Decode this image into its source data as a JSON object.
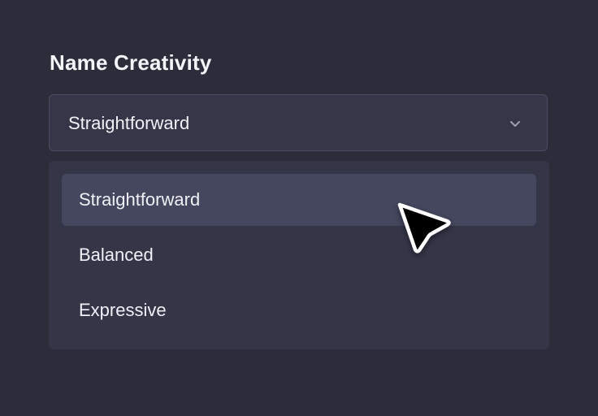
{
  "field": {
    "label": "Name Creativity",
    "selected_value": "Straightforward"
  },
  "icons": {
    "chevron": "chevron-down-icon",
    "cursor": "mouse-pointer-icon"
  },
  "dropdown": {
    "highlighted_index": 0,
    "options": [
      {
        "label": "Straightforward"
      },
      {
        "label": "Balanced"
      },
      {
        "label": "Expressive"
      }
    ]
  },
  "colors": {
    "background": "#2b2d3b",
    "field_background": "#353748",
    "menu_background": "#343648",
    "option_highlight": "#44475d",
    "text": "#f2f3f7"
  }
}
